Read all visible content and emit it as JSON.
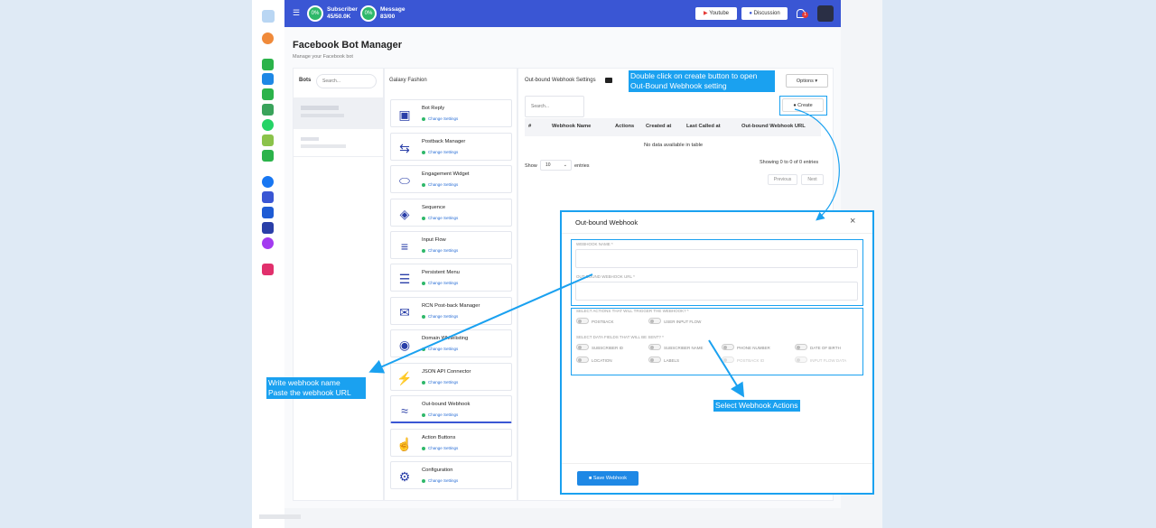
{
  "topbar": {
    "subscriber": {
      "percent": "0%",
      "label": "Subscriber",
      "value": "45/50.0K"
    },
    "message": {
      "percent": "0%",
      "label": "Message",
      "value": "83/00"
    },
    "youtube_label": "Youtube",
    "discussion_label": "Discussion",
    "notification_count": "1"
  },
  "page": {
    "title": "Facebook Bot Manager",
    "subtitle": "Manage your Facebook bot"
  },
  "bots": {
    "label": "Bots",
    "search_placeholder": "Search..."
  },
  "bot_panel": {
    "title": "Galaxy Fashion",
    "items": [
      {
        "title": "Bot Reply",
        "link": "Change Settings",
        "icon": "robot-icon"
      },
      {
        "title": "Postback Manager",
        "link": "Change Settings",
        "icon": "arrows-icon"
      },
      {
        "title": "Engagement Widget",
        "link": "Change Settings",
        "icon": "widget-icon"
      },
      {
        "title": "Sequence",
        "link": "Change Settings",
        "icon": "paint-bucket-icon"
      },
      {
        "title": "Input Flow",
        "link": "Change Settings",
        "icon": "stack-icon"
      },
      {
        "title": "Persistent Menu",
        "link": "Change Settings",
        "icon": "menu-icon"
      },
      {
        "title": "RCN Post-back Manager",
        "link": "Change Settings",
        "icon": "mail-icon"
      },
      {
        "title": "Domain Whitelisting",
        "link": "Change Settings",
        "icon": "globe-icon"
      },
      {
        "title": "JSON API Connector",
        "link": "Change Settings",
        "icon": "plug-icon"
      },
      {
        "title": "Out-bound Webhook",
        "link": "Change Settings",
        "icon": "wifi-icon"
      },
      {
        "title": "Action Buttons",
        "link": "Change Settings",
        "icon": "hand-pointer-icon"
      },
      {
        "title": "Configuration",
        "link": "Change Settings",
        "icon": "gear-icon"
      }
    ]
  },
  "webhook_settings": {
    "title": "Out-bound Webhook Settings",
    "options_label": "Options",
    "create_label": "Create",
    "search_placeholder": "Search...",
    "columns": [
      "#",
      "Webhook Name",
      "Actions",
      "Created at",
      "Last Called at",
      "Out-bound Webhook URL"
    ],
    "empty_text": "No data available in table",
    "show_label": "Show",
    "show_value": "10",
    "entries_label": "entries",
    "showing_text": "Showing 0 to 0 of 0 entries",
    "previous_label": "Previous",
    "next_label": "Next"
  },
  "modal": {
    "title": "Out-bound Webhook",
    "webhook_name_label": "WEBHOOK NAME *",
    "webhook_url_label": "OUT-BOUND WEBHOOK URL *",
    "actions_label": "SELECT ACTIONS THAT WILL TRIGGER THE WEBHOOK? *",
    "actions": [
      "POSTBACK",
      "USER INPUT FLOW"
    ],
    "fields_label": "SELECT DATA FIELDS THAT WILL BE SENT? *",
    "fields_row1": [
      "SUBSCRIBER ID",
      "SUBSCRIBER NAME",
      "PHONE NUMBER",
      "DATE OF BIRTH"
    ],
    "fields_row2": [
      "LOCATION",
      "LABELS",
      "POSTBACK ID",
      "INPUT FLOW DATA"
    ],
    "save_label": "Save Webhook"
  },
  "callouts": {
    "create_hint_line1": "Double click on create button to open",
    "create_hint_line2": "Out-Bound Webhook setting",
    "write_name": "Write webhook name",
    "paste_url": "Paste the webhook URL",
    "select_actions": "Select Webhook Actions"
  },
  "colors": {
    "primary": "#3a56d4",
    "callout": "#1aa1f0",
    "success": "#2fb86a"
  }
}
